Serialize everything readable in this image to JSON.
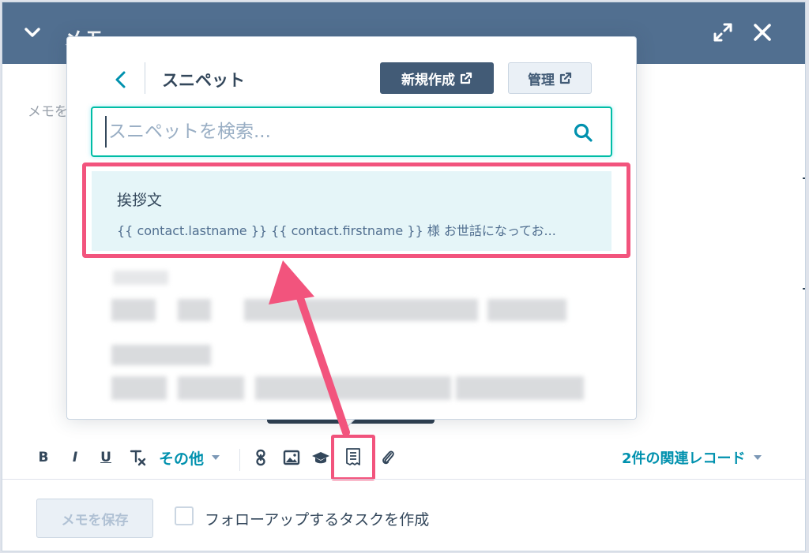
{
  "header": {
    "title": "メモ",
    "background": "#516f90"
  },
  "editor": {
    "placeholder": "メモを"
  },
  "popover": {
    "title": "スニペット",
    "new_button_label": "新規作成",
    "manage_button_label": "管理",
    "search": {
      "placeholder": "スニペットを検索...",
      "value": ""
    },
    "results": [
      {
        "title": "挨拶文",
        "body": "{{ contact.lastname }} {{ contact.firstname }} 様 お世話になってお..."
      }
    ]
  },
  "toolbar": {
    "bold_label": "B",
    "italic_label": "I",
    "underline_label": "U",
    "more_label": "その他",
    "related_records_label": "2件の関連レコード"
  },
  "footer": {
    "save_label": "メモを保存",
    "followup_task_label": "フォローアップするタスクを作成"
  },
  "colors": {
    "accent": "#0091ae",
    "highlight": "#f2547d",
    "search_focus": "#00bda5",
    "primary_button": "#425b76"
  },
  "icons": {
    "collapse": "chevron-down-icon",
    "expand": "expand-icon",
    "close": "close-icon",
    "back": "chevron-left-icon",
    "external": "external-link-icon",
    "search": "search-icon",
    "clear_format": "clear-format-icon",
    "link": "link-icon",
    "image": "image-icon",
    "meetings": "graduation-cap-icon",
    "snippet": "snippet-icon",
    "attachment": "paperclip-icon"
  }
}
